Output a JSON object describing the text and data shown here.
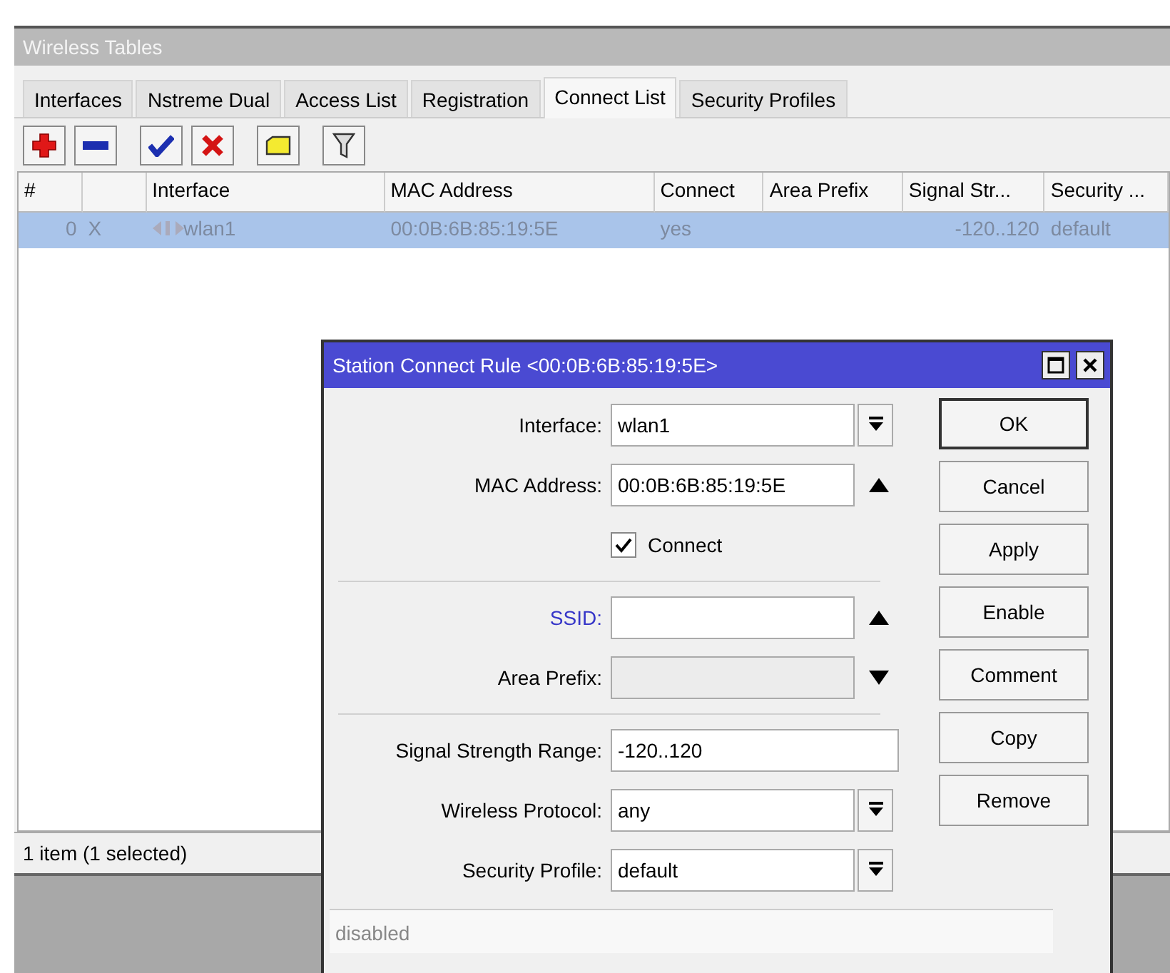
{
  "window": {
    "title": "Wireless Tables"
  },
  "tabs": [
    {
      "label": "Interfaces",
      "selected": false
    },
    {
      "label": "Nstreme Dual",
      "selected": false
    },
    {
      "label": "Access List",
      "selected": false
    },
    {
      "label": "Registration",
      "selected": false
    },
    {
      "label": "Connect List",
      "selected": true
    },
    {
      "label": "Security Profiles",
      "selected": false
    }
  ],
  "table": {
    "columns": [
      "#",
      "",
      "Interface",
      "MAC Address",
      "Connect",
      "Area Prefix",
      "Signal Str...",
      "Security ..."
    ],
    "rows": [
      {
        "selected": true,
        "disabled": true,
        "cells": [
          "0",
          "X",
          "wlan1",
          "00:0B:6B:85:19:5E",
          "yes",
          "",
          "-120..120",
          "default"
        ]
      }
    ]
  },
  "status_bar": "1 item (1 selected)",
  "dialog": {
    "title": "Station Connect Rule <00:0B:6B:85:19:5E>",
    "fields": [
      {
        "kind": "select",
        "label": "Interface:",
        "value": "wlan1"
      },
      {
        "kind": "text",
        "label": "MAC Address:",
        "value": "00:0B:6B:85:19:5E",
        "expanded": true
      },
      {
        "kind": "checkbox",
        "label": "Connect",
        "checked": true
      },
      {
        "kind": "separator"
      },
      {
        "kind": "text",
        "label": "SSID:",
        "highlighted": true,
        "expanded": true
      },
      {
        "kind": "text",
        "label": "Area Prefix:",
        "disabled": true,
        "expanded": false
      },
      {
        "kind": "separator"
      },
      {
        "kind": "text",
        "label": "Signal Strength Range:",
        "value": "-120..120"
      },
      {
        "kind": "select",
        "label": "Wireless Protocol:",
        "value": "any"
      },
      {
        "kind": "select",
        "label": "Security Profile:",
        "value": "default"
      }
    ],
    "buttons": [
      {
        "label": "OK",
        "default": true
      },
      {
        "label": "Cancel",
        "default": false
      },
      {
        "label": "Apply",
        "default": false
      },
      {
        "label": "Enable",
        "default": false
      },
      {
        "label": "Comment",
        "default": false
      },
      {
        "label": "Copy",
        "default": false
      },
      {
        "label": "Remove",
        "default": false
      }
    ],
    "status": "disabled"
  }
}
